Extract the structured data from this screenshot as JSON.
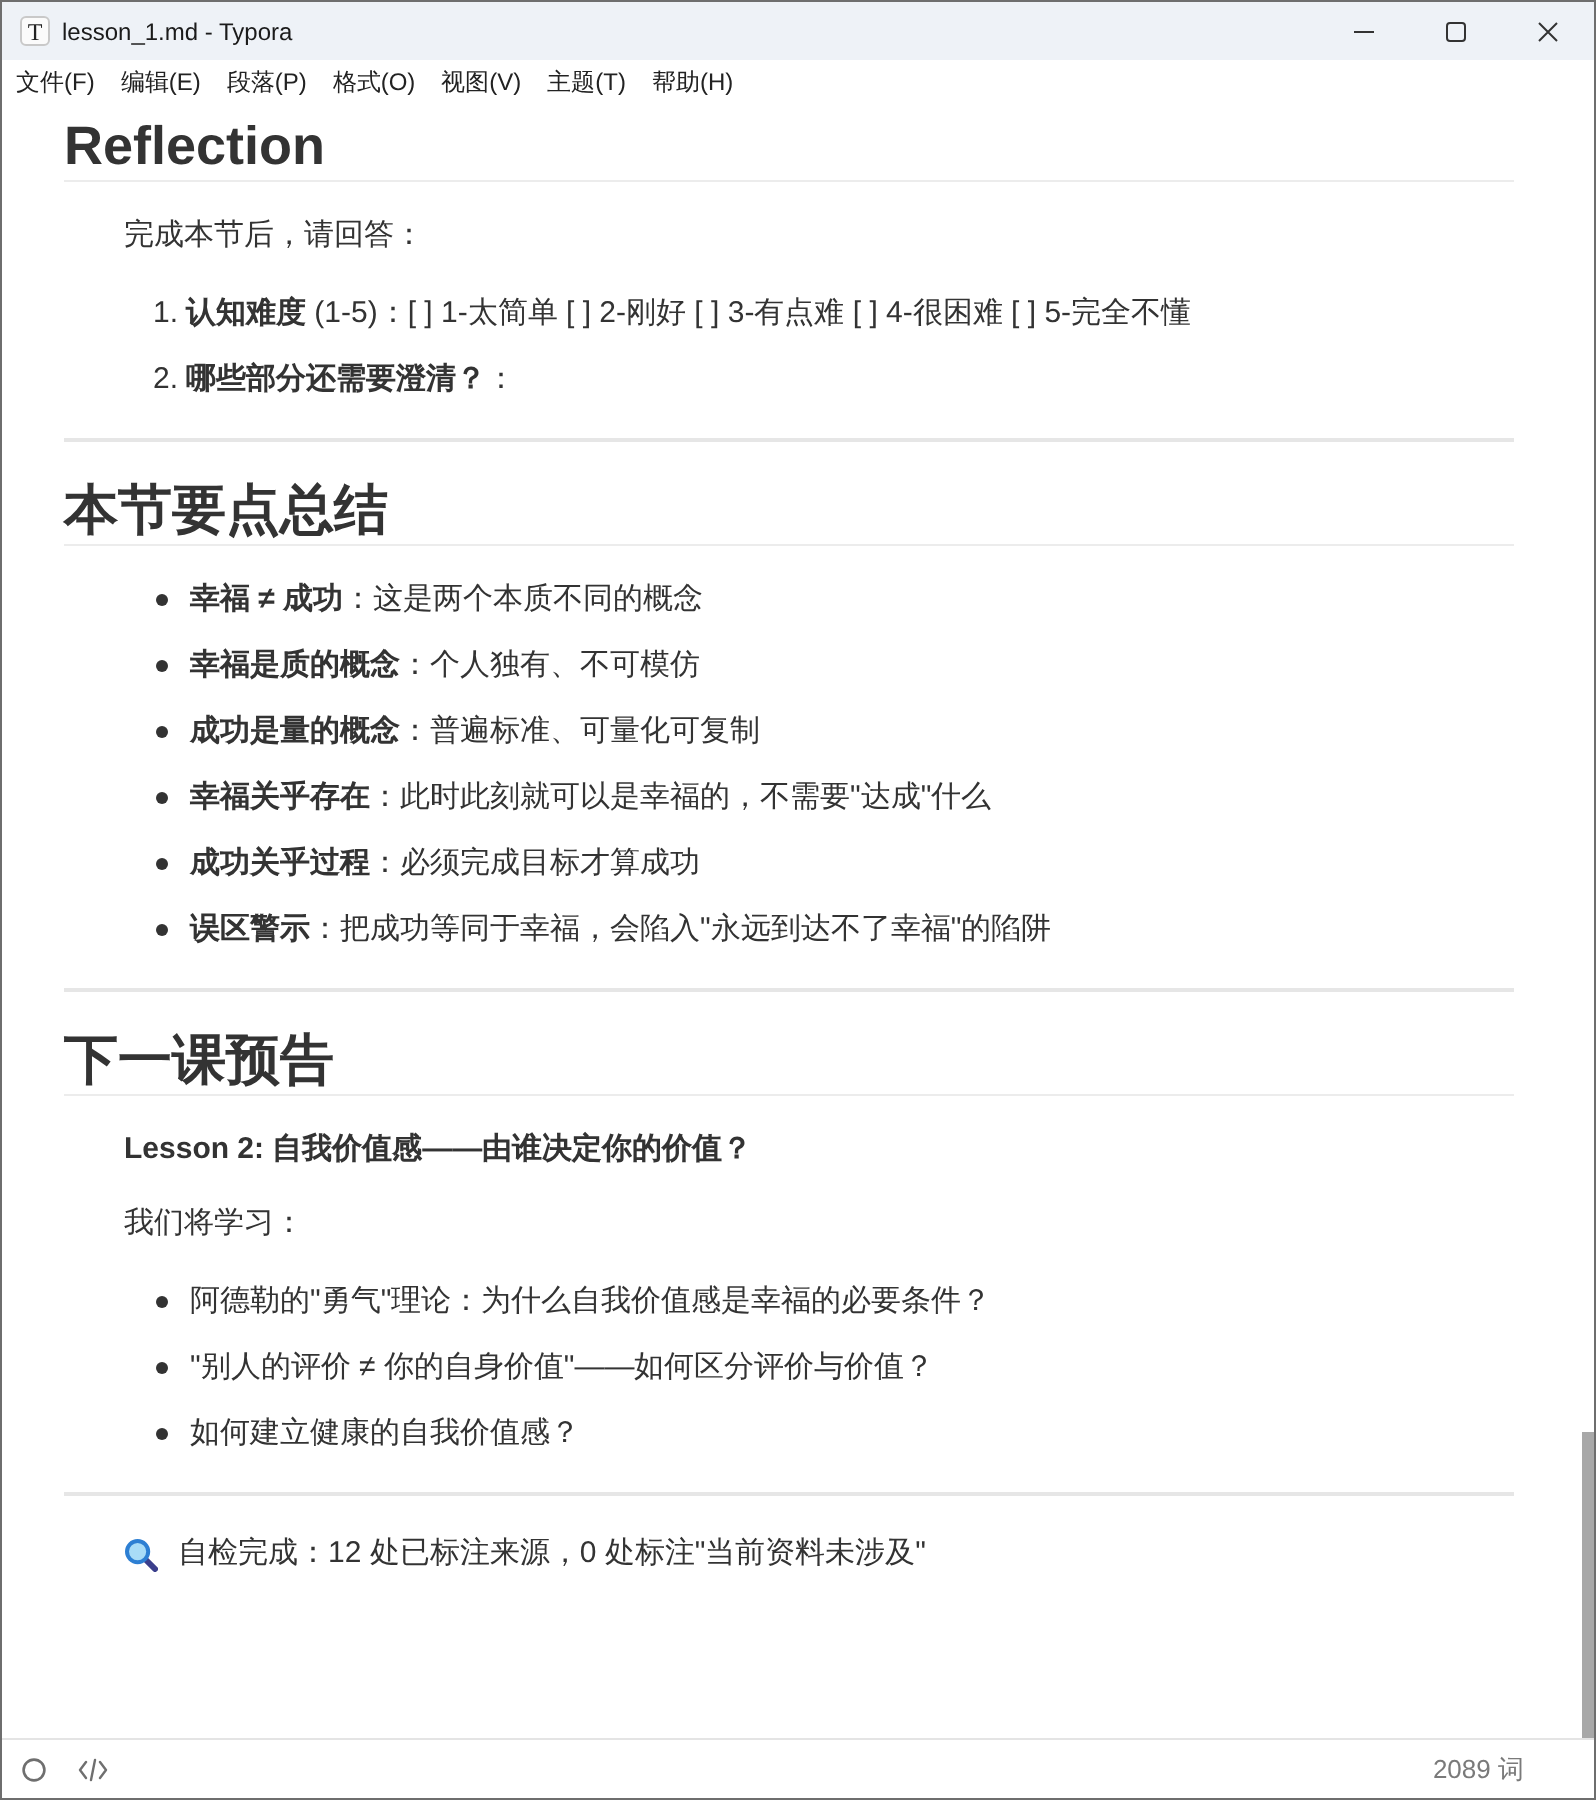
{
  "window": {
    "app_icon": "T",
    "title": "lesson_1.md - Typora"
  },
  "menu_bar": {
    "items": [
      "文件(F)",
      "编辑(E)",
      "段落(P)",
      "格式(O)",
      "视图(V)",
      "主题(T)",
      "帮助(H)"
    ]
  },
  "document": {
    "blocks": [
      {
        "kind": "heading",
        "text": "Reflection"
      },
      {
        "kind": "paragraph",
        "bold": false,
        "text": "完成本节后，请回答："
      },
      {
        "kind": "ordered_list",
        "items": [
          {
            "marker": "1.",
            "text": "**认知难度** (1-5)：[ ] 1-太简单 [ ] 2-刚好 [ ] 3-有点难 [ ] 4-很困难 [ ] 5-完全不懂"
          },
          {
            "marker": "2.",
            "text": "**哪些部分还需要澄清？**："
          }
        ]
      },
      {
        "kind": "rule"
      },
      {
        "kind": "heading",
        "text": "本节要点总结"
      },
      {
        "kind": "bullet_list",
        "items": [
          "**幸福 ≠ 成功**：这是两个本质不同的概念",
          "**幸福是质的概念**：个人独有、不可模仿",
          "**成功是量的概念**：普遍标准、可量化可复制",
          "**幸福关乎存在**：此时此刻就可以是幸福的，不需要\"达成\"什么",
          "**成功关乎过程**：必须完成目标才算成功",
          "**误区警示**：把成功等同于幸福，会陷入\"永远到达不了幸福\"的陷阱"
        ]
      },
      {
        "kind": "rule"
      },
      {
        "kind": "heading",
        "text": "下一课预告"
      },
      {
        "kind": "paragraph",
        "bold": true,
        "text": "Lesson 2: 自我价值感——由谁决定你的价值？"
      },
      {
        "kind": "paragraph",
        "bold": false,
        "text": "我们将学习："
      },
      {
        "kind": "bullet_list",
        "items": [
          "阿德勒的\"勇气\"理论：为什么自我价值感是幸福的必要条件？",
          "\"别人的评价 ≠ 你的自身价值\"——如何区分评价与价值？",
          "如何建立健康的自我价值感？"
        ]
      },
      {
        "kind": "rule"
      },
      {
        "kind": "note",
        "text": "自检完成：12 处已标注来源，0 处标注\"当前资料未涉及\""
      }
    ]
  },
  "status_bar": {
    "word_count": "2089 词"
  }
}
